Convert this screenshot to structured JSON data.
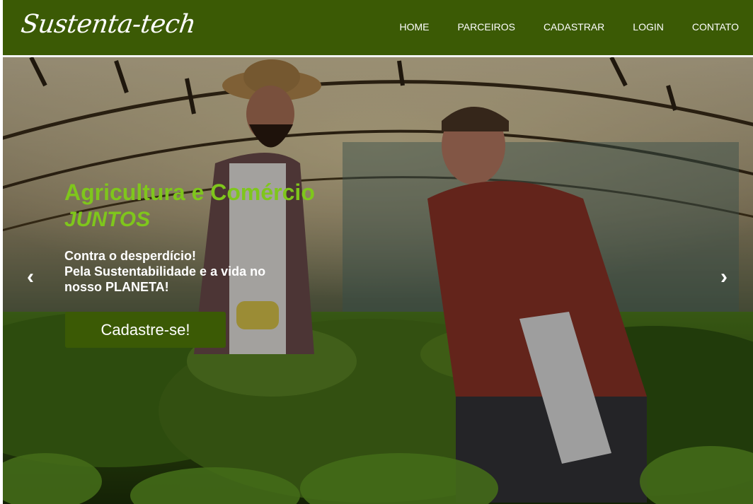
{
  "brand": {
    "name": "Sustenta-tech"
  },
  "nav": {
    "items": [
      {
        "label": "HOME"
      },
      {
        "label": "PARCEIROS"
      },
      {
        "label": "CADASTRAR"
      },
      {
        "label": "LOGIN"
      },
      {
        "label": "CONTATO"
      }
    ]
  },
  "hero": {
    "title": "Agricultura e Comércio",
    "subtitle": "JUNTOS",
    "tagline": [
      "Contra o desperdício!",
      "Pela Sustentabilidade e a vida no",
      "nosso PLANETA!"
    ],
    "cta_label": "Cadastre-se!",
    "prev_icon": "‹",
    "next_icon": "›"
  },
  "colors": {
    "nav_background": "#3b5a05",
    "accent_green": "#7fc61c",
    "button_background": "#3b5a05"
  },
  "icons": {
    "prev": "chevron-left-icon",
    "next": "chevron-right-icon"
  }
}
